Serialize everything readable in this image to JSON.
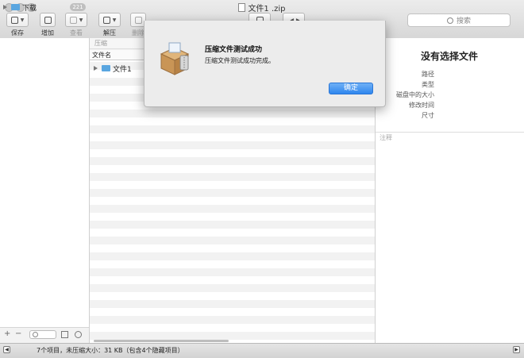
{
  "window": {
    "title": "文件1 .zip"
  },
  "toolbar": {
    "save_label": "保存",
    "add_label": "增加",
    "view_label": "查看",
    "extract_label": "解压",
    "delete_label": "删除"
  },
  "search": {
    "placeholder": "搜索"
  },
  "sidebar": {
    "items": [
      {
        "label": "下载",
        "badge": "221"
      }
    ]
  },
  "filelist": {
    "path_label": "压缩",
    "column_name": "文件名",
    "rows": [
      {
        "name": "文件1"
      }
    ]
  },
  "info": {
    "title": "没有选择文件",
    "labels": [
      "路径",
      "类型",
      "磁盘中的大小",
      "修改时间",
      "尺寸"
    ],
    "note_placeholder": "注释"
  },
  "status": {
    "text": "7个项目，未压缩大小：31 KB（包含4个隐藏项目）"
  },
  "dialog": {
    "title": "压缩文件测试成功",
    "message": "压缩文件测试成功完成。",
    "ok_label": "确定",
    "icon": "archive-box-icon"
  },
  "colors": {
    "accent": "#2f86ee",
    "folder": "#5aa6e0"
  }
}
